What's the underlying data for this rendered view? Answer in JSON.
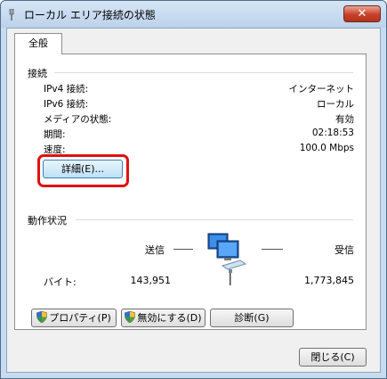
{
  "window": {
    "title": "ローカル エリア接続の状態",
    "close_glyph": "✕"
  },
  "tabs": [
    {
      "label": "全般"
    }
  ],
  "connection": {
    "heading": "接続",
    "rows": [
      {
        "label": "IPv4 接続:",
        "value": "インターネット"
      },
      {
        "label": "IPv6 接続:",
        "value": "ローカル"
      },
      {
        "label": "メディアの状態:",
        "value": "有効"
      },
      {
        "label": "期間:",
        "value": "02:18:53"
      },
      {
        "label": "速度:",
        "value": "100.0 Mbps"
      }
    ],
    "details_button": "詳細(E)..."
  },
  "activity": {
    "heading": "動作状況",
    "sent_label": "送信",
    "received_label": "受信",
    "bytes_label": "バイト:",
    "bytes_sent": "143,951",
    "bytes_received": "1,773,845"
  },
  "buttons": {
    "properties": "プロパティ(P)",
    "disable": "無効にする(D)",
    "diagnose": "診断(G)",
    "close": "閉じる(C)"
  },
  "icons": {
    "title": "network-plug-icon",
    "network": "network-computers-icon",
    "shield": "uac-shield-icon"
  },
  "colors": {
    "highlight": "#e01010",
    "titlebar": "#bcd2ea",
    "close_button": "#c8412a"
  }
}
